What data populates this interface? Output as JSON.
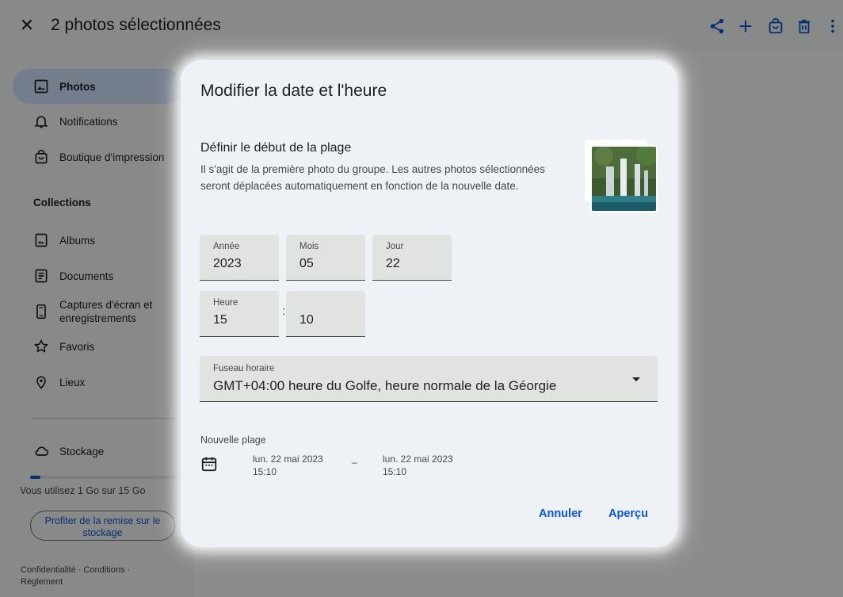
{
  "topbar": {
    "close_icon": "close-icon",
    "selection_title": "2 photos sélectionnées",
    "actions": [
      "share-icon",
      "add-icon",
      "print-shop-icon",
      "delete-icon",
      "more-vert-icon"
    ]
  },
  "sidebar": {
    "items": [
      {
        "label": "Photos",
        "icon": "photo-icon",
        "active": true
      },
      {
        "label": "Notifications",
        "icon": "bell-icon"
      },
      {
        "label": "Boutique d'impression",
        "icon": "shopping-bag-icon"
      }
    ],
    "collections_title": "Collections",
    "collections": [
      {
        "label": "Albums",
        "icon": "album-icon"
      },
      {
        "label": "Documents",
        "icon": "document-icon"
      },
      {
        "label": "Captures d'écran et enregistrements",
        "icon": "screenshot-icon"
      },
      {
        "label": "Favoris",
        "icon": "star-icon"
      },
      {
        "label": "Lieux",
        "icon": "location-icon"
      }
    ],
    "storage": {
      "label": "Stockage",
      "icon": "cloud-icon",
      "usage_text": "Vous utilisez 1 Go sur 15 Go",
      "used_fraction": 0.067,
      "promo_button": "Profiter de la remise sur le stockage"
    },
    "footer": "Confidentialité · Conditions · Règlement"
  },
  "dialog": {
    "title": "Modifier la date et l'heure",
    "subtitle": "Définir le début de la plage",
    "description": "Il s'agit de la première photo du groupe. Les autres photos sélectionnées seront déplacées automatiquement en fonction de la nouvelle date.",
    "fields": {
      "year": {
        "label": "Année",
        "value": "2023"
      },
      "month": {
        "label": "Mois",
        "value": "05"
      },
      "day": {
        "label": "Jour",
        "value": "22"
      },
      "hour": {
        "label": "Heure",
        "value": "15"
      },
      "separator": ":",
      "minute": {
        "value": "10"
      }
    },
    "timezone": {
      "label": "Fuseau horaire",
      "value": "GMT+04:00 heure du Golfe, heure normale de la Géorgie"
    },
    "new_range": {
      "label": "Nouvelle plage",
      "start_date": "lun. 22 mai 2023",
      "start_time": "15:10",
      "dash": "–",
      "end_date": "lun. 22 mai 2023",
      "end_time": "15:10"
    },
    "buttons": {
      "cancel": "Annuler",
      "preview": "Aperçu"
    }
  },
  "colors": {
    "accent": "#0b57d0",
    "active_nav": "#d3e3fd",
    "dialog_bg": "#eef2f7",
    "field_bg": "#e1e3e1"
  }
}
